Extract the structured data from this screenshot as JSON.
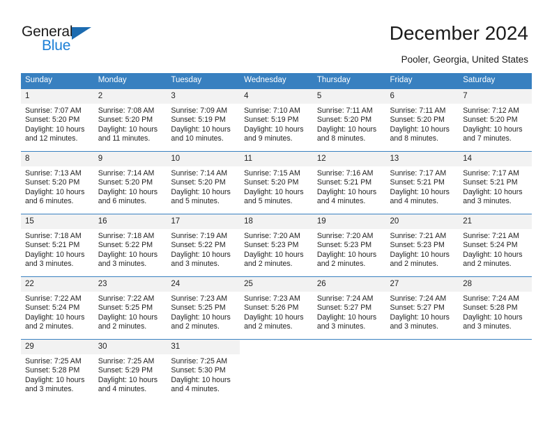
{
  "brand": {
    "name_part1": "General",
    "name_part2": "Blue",
    "triangle_color": "#1c6bb0",
    "blue_color": "#1c7fd6"
  },
  "header": {
    "title": "December 2024",
    "subtitle": "Pooler, Georgia, United States"
  },
  "theme": {
    "header_blue": "#3880c0",
    "daynum_band": "#f2f2f2",
    "text": "#222222"
  },
  "calendar": {
    "weekday_headers": [
      "Sunday",
      "Monday",
      "Tuesday",
      "Wednesday",
      "Thursday",
      "Friday",
      "Saturday"
    ],
    "weeks": [
      [
        {
          "day": "1",
          "sunrise": "Sunrise: 7:07 AM",
          "sunset": "Sunset: 5:20 PM",
          "daylight_line1": "Daylight: 10 hours",
          "daylight_line2": "and 12 minutes."
        },
        {
          "day": "2",
          "sunrise": "Sunrise: 7:08 AM",
          "sunset": "Sunset: 5:20 PM",
          "daylight_line1": "Daylight: 10 hours",
          "daylight_line2": "and 11 minutes."
        },
        {
          "day": "3",
          "sunrise": "Sunrise: 7:09 AM",
          "sunset": "Sunset: 5:19 PM",
          "daylight_line1": "Daylight: 10 hours",
          "daylight_line2": "and 10 minutes."
        },
        {
          "day": "4",
          "sunrise": "Sunrise: 7:10 AM",
          "sunset": "Sunset: 5:19 PM",
          "daylight_line1": "Daylight: 10 hours",
          "daylight_line2": "and 9 minutes."
        },
        {
          "day": "5",
          "sunrise": "Sunrise: 7:11 AM",
          "sunset": "Sunset: 5:20 PM",
          "daylight_line1": "Daylight: 10 hours",
          "daylight_line2": "and 8 minutes."
        },
        {
          "day": "6",
          "sunrise": "Sunrise: 7:11 AM",
          "sunset": "Sunset: 5:20 PM",
          "daylight_line1": "Daylight: 10 hours",
          "daylight_line2": "and 8 minutes."
        },
        {
          "day": "7",
          "sunrise": "Sunrise: 7:12 AM",
          "sunset": "Sunset: 5:20 PM",
          "daylight_line1": "Daylight: 10 hours",
          "daylight_line2": "and 7 minutes."
        }
      ],
      [
        {
          "day": "8",
          "sunrise": "Sunrise: 7:13 AM",
          "sunset": "Sunset: 5:20 PM",
          "daylight_line1": "Daylight: 10 hours",
          "daylight_line2": "and 6 minutes."
        },
        {
          "day": "9",
          "sunrise": "Sunrise: 7:14 AM",
          "sunset": "Sunset: 5:20 PM",
          "daylight_line1": "Daylight: 10 hours",
          "daylight_line2": "and 6 minutes."
        },
        {
          "day": "10",
          "sunrise": "Sunrise: 7:14 AM",
          "sunset": "Sunset: 5:20 PM",
          "daylight_line1": "Daylight: 10 hours",
          "daylight_line2": "and 5 minutes."
        },
        {
          "day": "11",
          "sunrise": "Sunrise: 7:15 AM",
          "sunset": "Sunset: 5:20 PM",
          "daylight_line1": "Daylight: 10 hours",
          "daylight_line2": "and 5 minutes."
        },
        {
          "day": "12",
          "sunrise": "Sunrise: 7:16 AM",
          "sunset": "Sunset: 5:21 PM",
          "daylight_line1": "Daylight: 10 hours",
          "daylight_line2": "and 4 minutes."
        },
        {
          "day": "13",
          "sunrise": "Sunrise: 7:17 AM",
          "sunset": "Sunset: 5:21 PM",
          "daylight_line1": "Daylight: 10 hours",
          "daylight_line2": "and 4 minutes."
        },
        {
          "day": "14",
          "sunrise": "Sunrise: 7:17 AM",
          "sunset": "Sunset: 5:21 PM",
          "daylight_line1": "Daylight: 10 hours",
          "daylight_line2": "and 3 minutes."
        }
      ],
      [
        {
          "day": "15",
          "sunrise": "Sunrise: 7:18 AM",
          "sunset": "Sunset: 5:21 PM",
          "daylight_line1": "Daylight: 10 hours",
          "daylight_line2": "and 3 minutes."
        },
        {
          "day": "16",
          "sunrise": "Sunrise: 7:18 AM",
          "sunset": "Sunset: 5:22 PM",
          "daylight_line1": "Daylight: 10 hours",
          "daylight_line2": "and 3 minutes."
        },
        {
          "day": "17",
          "sunrise": "Sunrise: 7:19 AM",
          "sunset": "Sunset: 5:22 PM",
          "daylight_line1": "Daylight: 10 hours",
          "daylight_line2": "and 3 minutes."
        },
        {
          "day": "18",
          "sunrise": "Sunrise: 7:20 AM",
          "sunset": "Sunset: 5:23 PM",
          "daylight_line1": "Daylight: 10 hours",
          "daylight_line2": "and 2 minutes."
        },
        {
          "day": "19",
          "sunrise": "Sunrise: 7:20 AM",
          "sunset": "Sunset: 5:23 PM",
          "daylight_line1": "Daylight: 10 hours",
          "daylight_line2": "and 2 minutes."
        },
        {
          "day": "20",
          "sunrise": "Sunrise: 7:21 AM",
          "sunset": "Sunset: 5:23 PM",
          "daylight_line1": "Daylight: 10 hours",
          "daylight_line2": "and 2 minutes."
        },
        {
          "day": "21",
          "sunrise": "Sunrise: 7:21 AM",
          "sunset": "Sunset: 5:24 PM",
          "daylight_line1": "Daylight: 10 hours",
          "daylight_line2": "and 2 minutes."
        }
      ],
      [
        {
          "day": "22",
          "sunrise": "Sunrise: 7:22 AM",
          "sunset": "Sunset: 5:24 PM",
          "daylight_line1": "Daylight: 10 hours",
          "daylight_line2": "and 2 minutes."
        },
        {
          "day": "23",
          "sunrise": "Sunrise: 7:22 AM",
          "sunset": "Sunset: 5:25 PM",
          "daylight_line1": "Daylight: 10 hours",
          "daylight_line2": "and 2 minutes."
        },
        {
          "day": "24",
          "sunrise": "Sunrise: 7:23 AM",
          "sunset": "Sunset: 5:25 PM",
          "daylight_line1": "Daylight: 10 hours",
          "daylight_line2": "and 2 minutes."
        },
        {
          "day": "25",
          "sunrise": "Sunrise: 7:23 AM",
          "sunset": "Sunset: 5:26 PM",
          "daylight_line1": "Daylight: 10 hours",
          "daylight_line2": "and 2 minutes."
        },
        {
          "day": "26",
          "sunrise": "Sunrise: 7:24 AM",
          "sunset": "Sunset: 5:27 PM",
          "daylight_line1": "Daylight: 10 hours",
          "daylight_line2": "and 3 minutes."
        },
        {
          "day": "27",
          "sunrise": "Sunrise: 7:24 AM",
          "sunset": "Sunset: 5:27 PM",
          "daylight_line1": "Daylight: 10 hours",
          "daylight_line2": "and 3 minutes."
        },
        {
          "day": "28",
          "sunrise": "Sunrise: 7:24 AM",
          "sunset": "Sunset: 5:28 PM",
          "daylight_line1": "Daylight: 10 hours",
          "daylight_line2": "and 3 minutes."
        }
      ],
      [
        {
          "day": "29",
          "sunrise": "Sunrise: 7:25 AM",
          "sunset": "Sunset: 5:28 PM",
          "daylight_line1": "Daylight: 10 hours",
          "daylight_line2": "and 3 minutes."
        },
        {
          "day": "30",
          "sunrise": "Sunrise: 7:25 AM",
          "sunset": "Sunset: 5:29 PM",
          "daylight_line1": "Daylight: 10 hours",
          "daylight_line2": "and 4 minutes."
        },
        {
          "day": "31",
          "sunrise": "Sunrise: 7:25 AM",
          "sunset": "Sunset: 5:30 PM",
          "daylight_line1": "Daylight: 10 hours",
          "daylight_line2": "and 4 minutes."
        },
        {
          "day": "",
          "sunrise": "",
          "sunset": "",
          "daylight_line1": "",
          "daylight_line2": ""
        },
        {
          "day": "",
          "sunrise": "",
          "sunset": "",
          "daylight_line1": "",
          "daylight_line2": ""
        },
        {
          "day": "",
          "sunrise": "",
          "sunset": "",
          "daylight_line1": "",
          "daylight_line2": ""
        },
        {
          "day": "",
          "sunrise": "",
          "sunset": "",
          "daylight_line1": "",
          "daylight_line2": ""
        }
      ]
    ]
  }
}
